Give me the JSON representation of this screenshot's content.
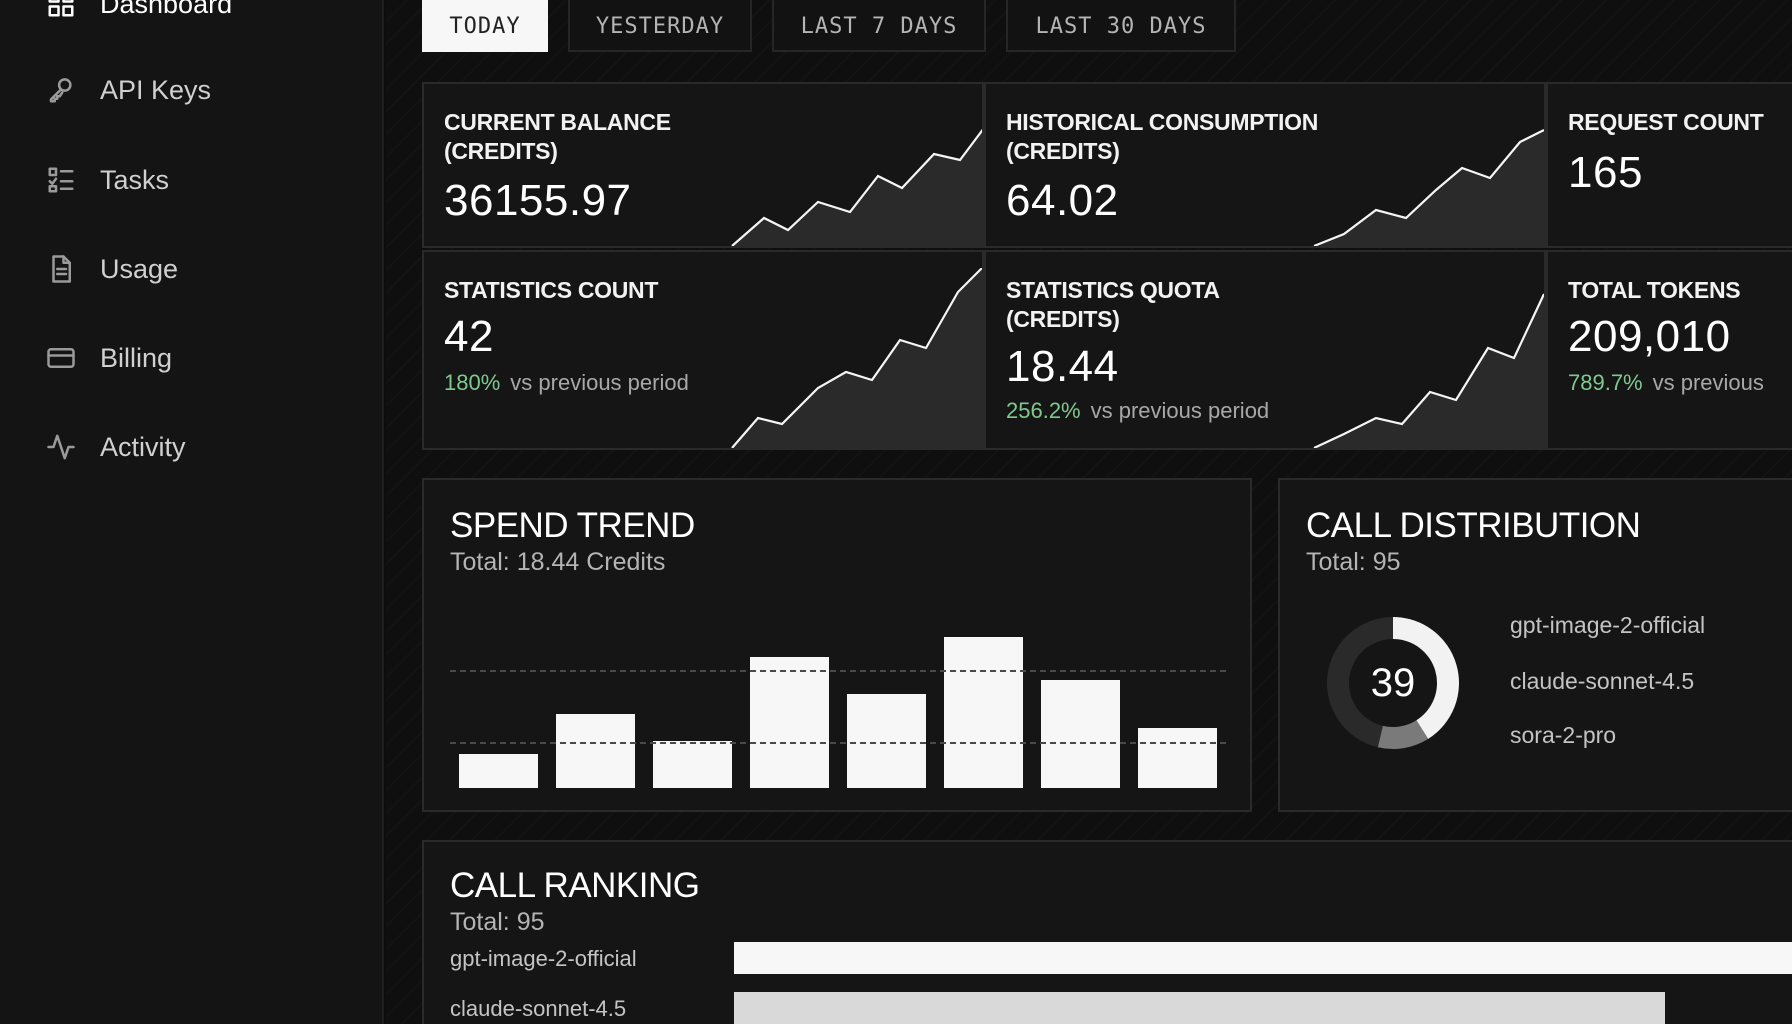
{
  "sidebar": {
    "items": [
      {
        "label": "Dashboard",
        "icon": "dashboard-icon",
        "active": true
      },
      {
        "label": "API Keys",
        "icon": "key-icon"
      },
      {
        "label": "Tasks",
        "icon": "tasks-icon"
      },
      {
        "label": "Usage",
        "icon": "document-icon"
      },
      {
        "label": "Billing",
        "icon": "credit-card-icon"
      },
      {
        "label": "Activity",
        "icon": "activity-icon"
      }
    ]
  },
  "date_tabs": [
    "TODAY",
    "YESTERDAY",
    "LAST 7 DAYS",
    "LAST 30 DAYS"
  ],
  "stats": [
    {
      "title": "CURRENT BALANCE (CREDITS)",
      "value": "36155.97"
    },
    {
      "title": "HISTORICAL CONSUMPTION (CREDITS)",
      "value": "64.02"
    },
    {
      "title": "REQUEST COUNT",
      "value": "165"
    },
    {
      "title": "STATISTICS COUNT",
      "value": "42",
      "change": "180%",
      "vs": "vs previous period"
    },
    {
      "title": "STATISTICS QUOTA (CREDITS)",
      "value": "18.44",
      "change": "256.2%",
      "vs": "vs previous period"
    },
    {
      "title": "TOTAL TOKENS",
      "value": "209,010",
      "change": "789.7%",
      "vs": "vs previous"
    }
  ],
  "spend_trend": {
    "title": "SPEND TREND",
    "total": "Total: 18.44 Credits"
  },
  "call_distribution": {
    "title": "CALL DISTRIBUTION",
    "total": "Total: 95",
    "center_value": "39",
    "legend": [
      "gpt-image-2-official",
      "claude-sonnet-4.5",
      "sora-2-pro"
    ]
  },
  "call_ranking": {
    "title": "CALL RANKING",
    "total": "Total: 95",
    "rows": [
      "gpt-image-2-official",
      "claude-sonnet-4.5"
    ]
  },
  "chart_data": [
    {
      "type": "bar",
      "title": "SPEND TREND",
      "categories": [],
      "values": [
        1.0,
        2.2,
        1.4,
        3.9,
        2.8,
        4.5,
        3.2,
        1.8
      ],
      "ylim": [
        0,
        5
      ]
    },
    {
      "type": "pie",
      "title": "CALL DISTRIBUTION",
      "labels": [
        "gpt-image-2-official",
        "claude-sonnet-4.5",
        "sora-2-pro"
      ],
      "values": [
        39,
        12,
        44
      ],
      "colors": [
        "#f2f2f2",
        "#7a7a7a",
        "#2a2a2a"
      ]
    },
    {
      "type": "bar",
      "title": "CALL RANKING",
      "categories": [
        "gpt-image-2-official",
        "claude-sonnet-4.5"
      ],
      "values": [
        39,
        33
      ],
      "colors": [
        "#f7f7f7",
        "#d9d9d9"
      ]
    }
  ],
  "colors": {
    "accent_positive": "#7fc98f",
    "bar": "#f7f7f7",
    "background": "#0d0d0d"
  }
}
